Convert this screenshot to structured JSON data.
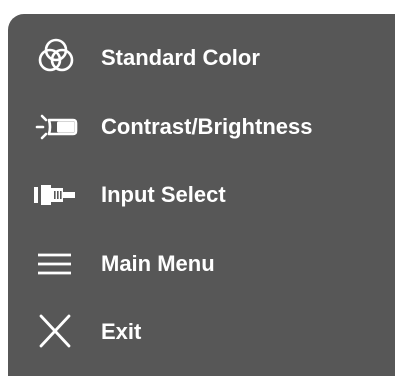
{
  "osd_menu": {
    "items": [
      {
        "label": "Standard Color",
        "icon": "color-circles-icon"
      },
      {
        "label": "Contrast/Brightness",
        "icon": "brightness-icon"
      },
      {
        "label": "Input Select",
        "icon": "input-connector-icon"
      },
      {
        "label": "Main Menu",
        "icon": "hamburger-menu-icon"
      },
      {
        "label": "Exit",
        "icon": "close-icon"
      }
    ]
  },
  "colors": {
    "panel_background": "#575757",
    "text": "#ffffff",
    "page_background": "#ffffff"
  }
}
